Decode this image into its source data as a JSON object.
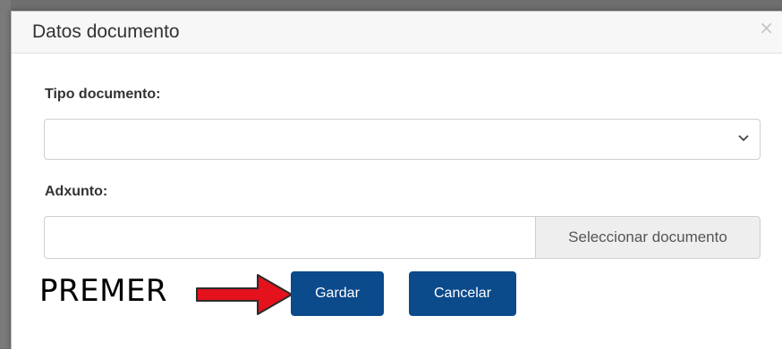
{
  "dialog": {
    "title": "Datos documento",
    "close_glyph": "×"
  },
  "form": {
    "tipo_documento_label": "Tipo documento:",
    "tipo_documento_value": "",
    "adxunto_label": "Adxunto:",
    "adxunto_value": "",
    "select_file_label": "Seleccionar documento"
  },
  "buttons": {
    "save_label": "Gardar",
    "cancel_label": "Cancelar"
  },
  "annotation": {
    "text": "PREMER",
    "arrow_color": "#e3121c"
  },
  "colors": {
    "primary_button": "#0b4a8b",
    "header_bg": "#f7f7f7"
  },
  "icons": {
    "close": "close-icon",
    "select_caret": "chevron-down-icon",
    "annotation_arrow": "arrow-right-icon"
  }
}
